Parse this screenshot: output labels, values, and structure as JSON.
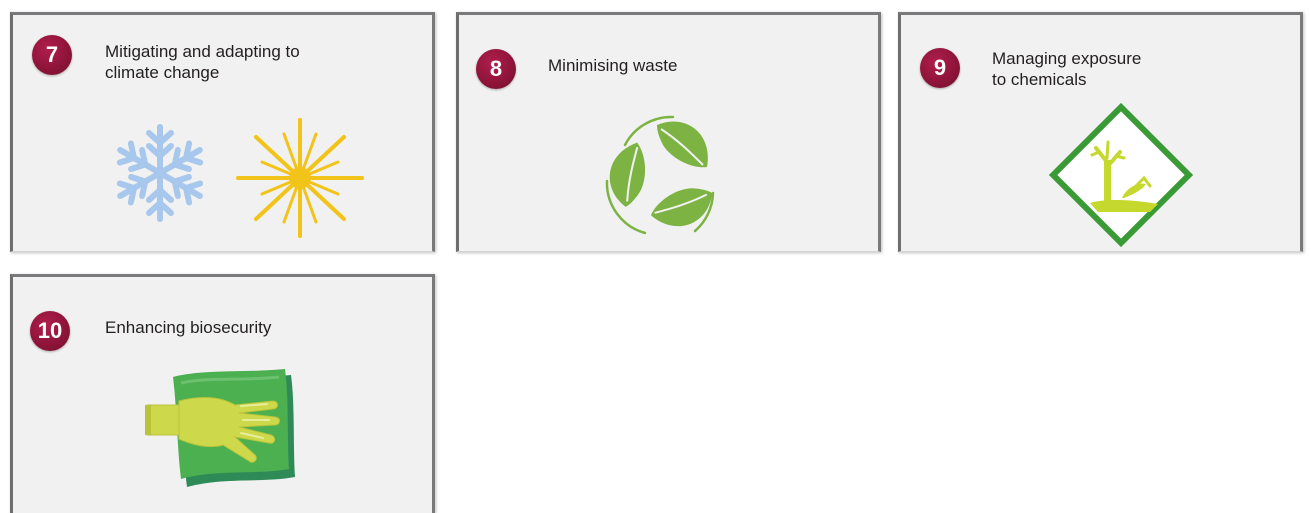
{
  "cards": [
    {
      "number": "7",
      "title": "Mitigating and adapting to\nclimate change",
      "icons": [
        "snowflake-icon",
        "sun-icon"
      ]
    },
    {
      "number": "8",
      "title": "Minimising waste",
      "icons": [
        "recycle-leaves-icon"
      ]
    },
    {
      "number": "9",
      "title": "Managing exposure\nto chemicals",
      "icons": [
        "environmental-hazard-icon"
      ]
    },
    {
      "number": "10",
      "title": "Enhancing biosecurity",
      "icons": [
        "glove-cloth-icon"
      ]
    }
  ],
  "colors": {
    "badge": "#8c1438",
    "card_background": "#f1f1f2",
    "snowflake": "#a7c8ec",
    "sun": "#f2c318",
    "recycle": "#7cb342",
    "hazard_border": "#3a9a35",
    "hazard_symbol": "#c4d82e",
    "glove": "#cdd84a",
    "cloth": "#4caf50"
  }
}
